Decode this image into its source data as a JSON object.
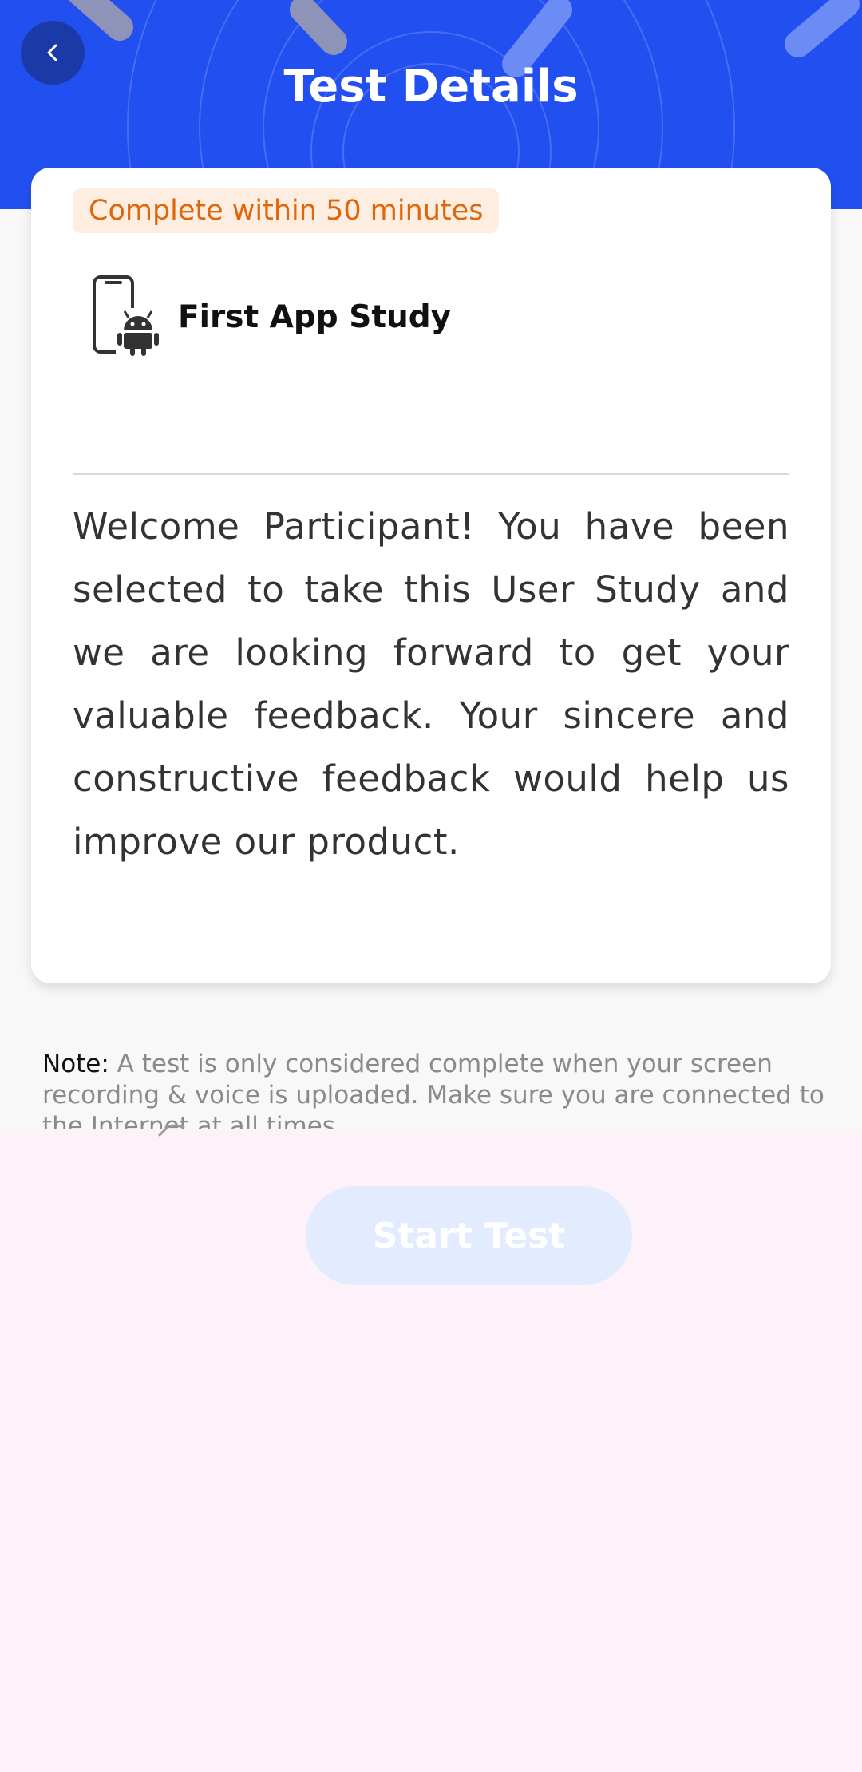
{
  "header": {
    "title": "Test Details",
    "back_icon": "chevron-left-icon",
    "background_color": "#2250f0"
  },
  "card": {
    "time_badge": "Complete within 50 minutes",
    "app_icon": "android-phone-icon",
    "study_title": "First App Study",
    "description": "Welcome Participant! You have been selected to take this User Study and we are looking forward to get your valuable feedback. Your sincere and constructive feedback would help us improve our product."
  },
  "note": {
    "label": "Note:",
    "text": " A test is only considered complete when your screen recording & voice is uploaded. Make sure you are connected to the Internet at all times."
  },
  "actions": {
    "start_label": "Start Test"
  },
  "colors": {
    "accent": "#2250f0",
    "badge_text": "#e0660a",
    "badge_bg": "#fdeee1"
  }
}
